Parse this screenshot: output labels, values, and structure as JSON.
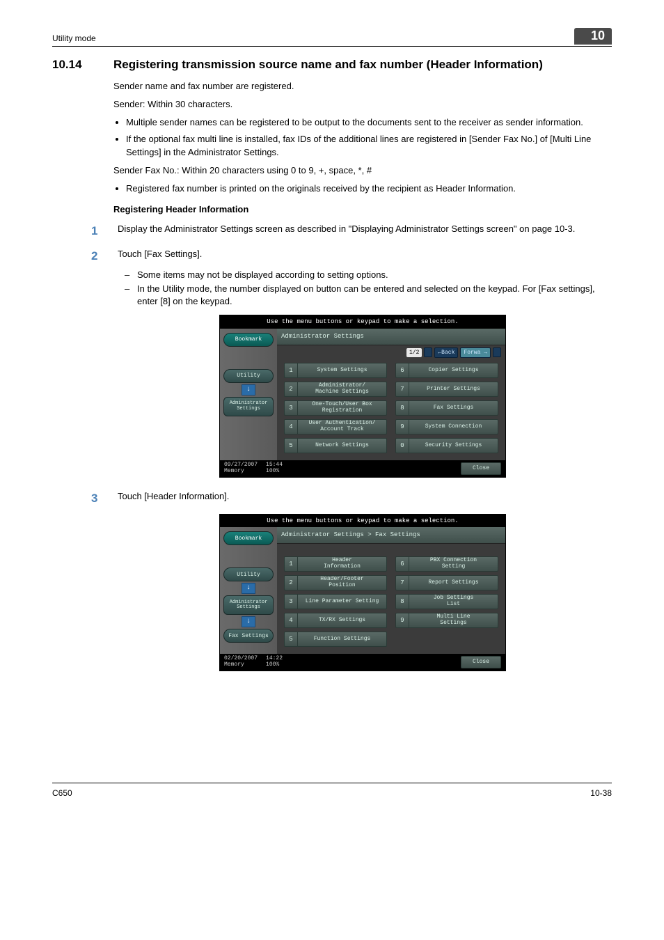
{
  "header": {
    "running": "Utility mode",
    "chapter": "10"
  },
  "section": {
    "number": "10.14",
    "title": "Registering transmission source name and fax number (Header Information)"
  },
  "intro": {
    "p1": "Sender name and fax number are registered.",
    "p2": "Sender: Within 30 characters.",
    "bullets": [
      "Multiple sender names can be registered to be output to the documents sent to the receiver as sender information.",
      "If the optional fax multi line is installed, fax IDs of the additional lines are registered in [Sender Fax No.] of [Multi Line Settings] in the Administrator Settings."
    ],
    "p3": "Sender Fax No.: Within 20 characters using 0 to 9, +, space, *, #",
    "bullets2": [
      "Registered fax number is printed on the originals received by the recipient as Header Information."
    ]
  },
  "subhead": "Registering Header Information",
  "steps": {
    "s1": {
      "num": "1",
      "text": "Display the Administrator Settings screen as described in \"Displaying Administrator Settings screen\" on page 10-3."
    },
    "s2": {
      "num": "2",
      "text": "Touch [Fax Settings].",
      "dashes": [
        "Some items may not be displayed according to setting options.",
        "In the Utility mode, the number displayed on button can be entered and selected on the keypad. For [Fax settings], enter [8] on the keypad."
      ]
    },
    "s3": {
      "num": "3",
      "text": "Touch [Header Information]."
    }
  },
  "screen_common": {
    "hint": "Use the menu buttons or keypad to make a selection.",
    "bookmark": "Bookmark",
    "utility": "Utility",
    "admin_settings": "Administrator\nSettings",
    "fax_settings": "Fax Settings",
    "close": "Close",
    "memory_label": "Memory",
    "memory_val": "100%",
    "back": "←Back",
    "forward": "Forward →"
  },
  "screen1": {
    "breadcrumb": "Administrator Settings",
    "page": "1/2",
    "menu": [
      {
        "n": "1",
        "label": "System Settings"
      },
      {
        "n": "6",
        "label": "Copier Settings"
      },
      {
        "n": "2",
        "label": "Administrator/\nMachine Settings"
      },
      {
        "n": "7",
        "label": "Printer Settings"
      },
      {
        "n": "3",
        "label": "One-Touch/User Box\nRegistration"
      },
      {
        "n": "8",
        "label": "Fax Settings"
      },
      {
        "n": "4",
        "label": "User Authentication/\nAccount Track"
      },
      {
        "n": "9",
        "label": "System Connection"
      },
      {
        "n": "5",
        "label": "Network Settings"
      },
      {
        "n": "0",
        "label": "Security Settings"
      }
    ],
    "date": "09/27/2007",
    "time": "15:44"
  },
  "screen2": {
    "breadcrumb": "Administrator Settings  >  Fax Settings",
    "menu": [
      {
        "n": "1",
        "label": "Header\nInformation"
      },
      {
        "n": "6",
        "label": "PBX Connection\nSetting"
      },
      {
        "n": "2",
        "label": "Header/Footer\nPosition"
      },
      {
        "n": "7",
        "label": "Report Settings"
      },
      {
        "n": "3",
        "label": "Line Parameter Setting"
      },
      {
        "n": "8",
        "label": "Job Settings\nList"
      },
      {
        "n": "4",
        "label": "TX/RX Settings"
      },
      {
        "n": "9",
        "label": "Multi Line\nSettings"
      },
      {
        "n": "5",
        "label": "Function Settings"
      }
    ],
    "date": "02/20/2007",
    "time": "14:22"
  },
  "footer": {
    "left": "C650",
    "right": "10-38"
  }
}
